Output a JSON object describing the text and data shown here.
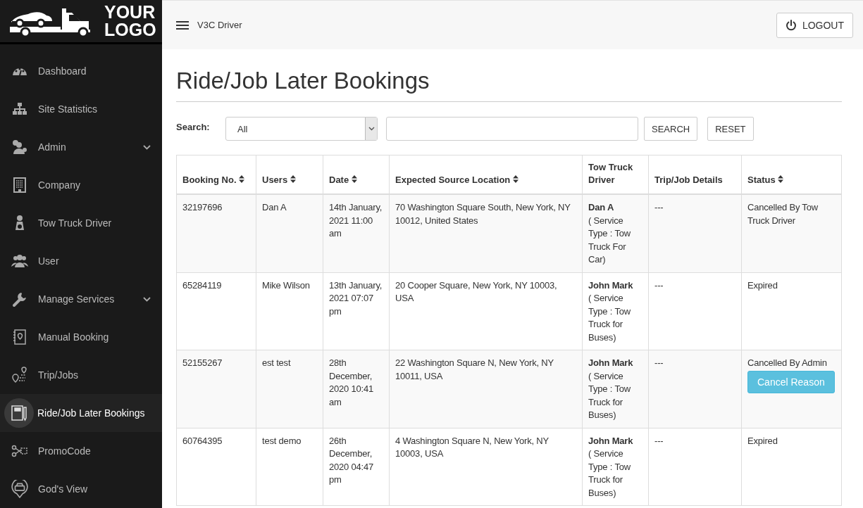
{
  "logo": {
    "line_1": "YOUR",
    "line_2": "LOGO"
  },
  "sidebar": {
    "items": [
      {
        "label": "Dashboard",
        "selected": false,
        "expandable": false
      },
      {
        "label": "Site Statistics",
        "selected": false,
        "expandable": false
      },
      {
        "label": "Admin",
        "selected": false,
        "expandable": true
      },
      {
        "label": "Company",
        "selected": false,
        "expandable": false
      },
      {
        "label": "Tow Truck Driver",
        "selected": false,
        "expandable": false
      },
      {
        "label": "User",
        "selected": false,
        "expandable": false
      },
      {
        "label": "Manage Services",
        "selected": false,
        "expandable": true
      },
      {
        "label": "Manual Booking",
        "selected": false,
        "expandable": false
      },
      {
        "label": "Trip/Jobs",
        "selected": false,
        "expandable": false
      },
      {
        "label": "Ride/Job Later Bookings",
        "selected": true,
        "expandable": false
      },
      {
        "label": "PromoCode",
        "selected": false,
        "expandable": false
      },
      {
        "label": "God's View",
        "selected": false,
        "expandable": false
      }
    ]
  },
  "header": {
    "app_name": "V3C Driver",
    "logout": "LOGOUT"
  },
  "page_title": "Ride/Job Later Bookings",
  "search": {
    "label": "Search:",
    "filter_value": "All",
    "search_button": "SEARCH",
    "reset_button": "RESET"
  },
  "table": {
    "columns": [
      {
        "label": "Booking No.",
        "sortable": true
      },
      {
        "label": "Users",
        "sortable": true
      },
      {
        "label": "Date",
        "sortable": true
      },
      {
        "label": "Expected Source Location",
        "sortable": true
      },
      {
        "label": "Tow Truck Driver",
        "sortable": false
      },
      {
        "label": "Trip/Job Details",
        "sortable": false
      },
      {
        "label": "Status",
        "sortable": true
      }
    ],
    "rows": [
      {
        "booking_no": "32197696",
        "user": "Dan A",
        "date": "14th January, 2021 11:00 am",
        "location": "70 Washington Square South, New York, NY 10012, United States",
        "driver": "Dan A",
        "service": "( Service Type : Tow Truck For Car)",
        "details": "---",
        "status": "Cancelled By Tow Truck Driver"
      },
      {
        "booking_no": "65284119",
        "user": "Mike Wilson",
        "date": "13th January, 2021 07:07 pm",
        "location": "20 Cooper Square, New York, NY 10003, USA",
        "driver": "John Mark",
        "service": "( Service Type : Tow Truck for Buses)",
        "details": "---",
        "status": "Expired"
      },
      {
        "booking_no": "52155267",
        "user": "est test",
        "date": "28th December, 2020 10:41 am",
        "location": "22 Washington Square N, New York, NY 10011, USA",
        "driver": "John Mark",
        "service": "( Service Type : Tow Truck for Buses)",
        "details": "---",
        "status": "Cancelled By Admin",
        "action": "Cancel Reason"
      },
      {
        "booking_no": "60764395",
        "user": "test demo",
        "date": "26th December, 2020 04:47 pm",
        "location": "4 Washington Square N, New York, NY 10003, USA",
        "driver": "John Mark",
        "service": "( Service Type : Tow Truck for Buses)",
        "details": "---",
        "status": "Expired"
      }
    ]
  }
}
